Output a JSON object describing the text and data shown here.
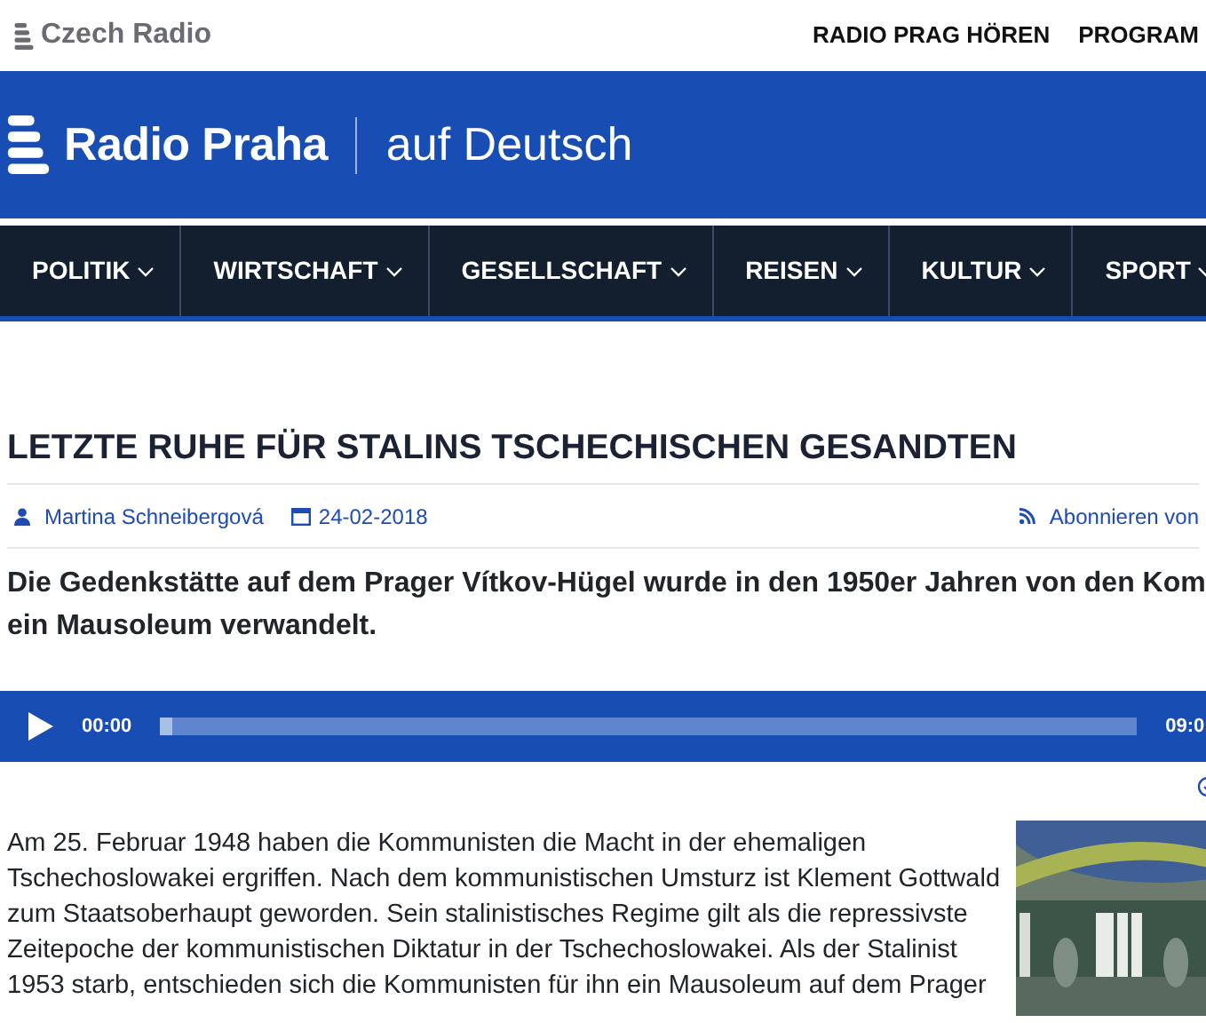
{
  "header": {
    "brand": "Czech Radio",
    "links": [
      "RADIO PRAG HÖREN",
      "PROGRAM"
    ]
  },
  "masthead": {
    "title": "Radio Praha",
    "subtitle": "auf Deutsch"
  },
  "nav": [
    {
      "label": "POLITIK"
    },
    {
      "label": "WIRTSCHAFT"
    },
    {
      "label": "GESELLSCHAFT"
    },
    {
      "label": "REISEN"
    },
    {
      "label": "KULTUR"
    },
    {
      "label": "SPORT"
    }
  ],
  "article": {
    "title": "LETZTE RUHE FÜR STALINS TSCHECHISCHEN GESANDTEN",
    "author": "Martina Schneibergová",
    "date": "24-02-2018",
    "subscribe": "Abonnieren von",
    "lead": "Die Gedenkstätte auf dem Prager Vítkov-Hügel wurde in den 1950er Jahren von den Kom\nein Mausoleum verwandelt.",
    "player": {
      "time": "00:00",
      "duration": "09:0",
      "level": 0.012
    },
    "body": "Am 25. Februar 1948 haben die Kommunisten die Macht in der ehemaligen Tschechoslowakei ergriffen. Nach dem kommunistischen Umsturz ist Klement Gottwald zum Staatsoberhaupt geworden. Sein stalinistisches Regime gilt als die repressivste Zeitepoche der kommunistischen Diktatur in der Tschechoslowakei. Als der Stalinist 1953 starb, entschieden sich die Kommunisten für ihn ein Mausoleum auf dem Prager"
  }
}
